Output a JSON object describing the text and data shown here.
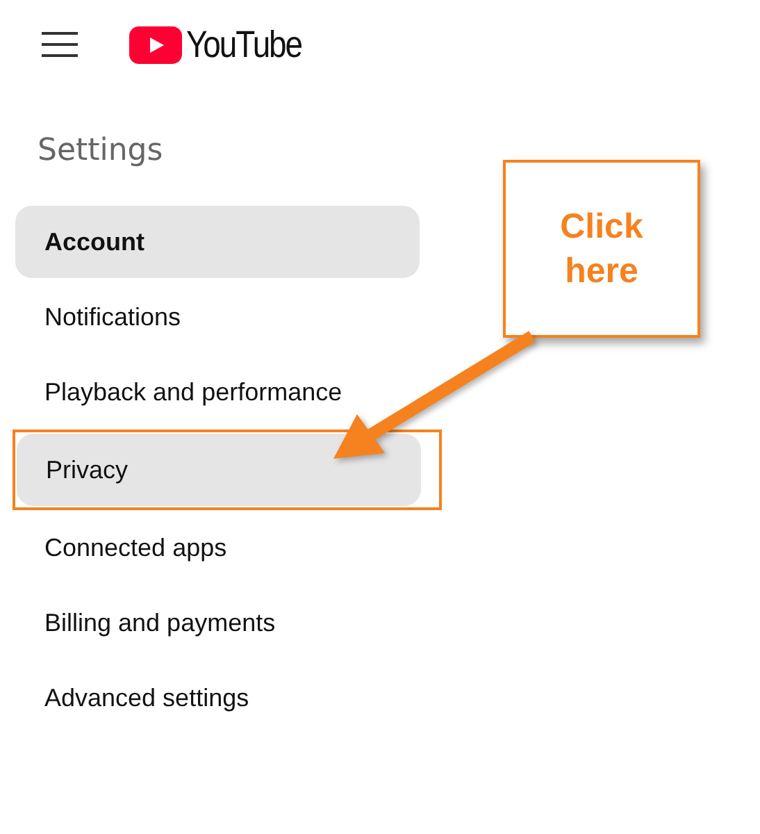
{
  "header": {
    "logo_text": "YouTube"
  },
  "page_title": "Settings",
  "items": [
    {
      "label": "Account",
      "selected": true,
      "highlighted": false
    },
    {
      "label": "Notifications",
      "selected": false,
      "highlighted": false
    },
    {
      "label": "Playback and performance",
      "selected": false,
      "highlighted": false
    },
    {
      "label": "Privacy",
      "selected": false,
      "highlighted": true
    },
    {
      "label": "Connected apps",
      "selected": false,
      "highlighted": false
    },
    {
      "label": "Billing and payments",
      "selected": false,
      "highlighted": false
    },
    {
      "label": "Advanced settings",
      "selected": false,
      "highlighted": false
    }
  ],
  "callout": {
    "text": "Click here"
  }
}
